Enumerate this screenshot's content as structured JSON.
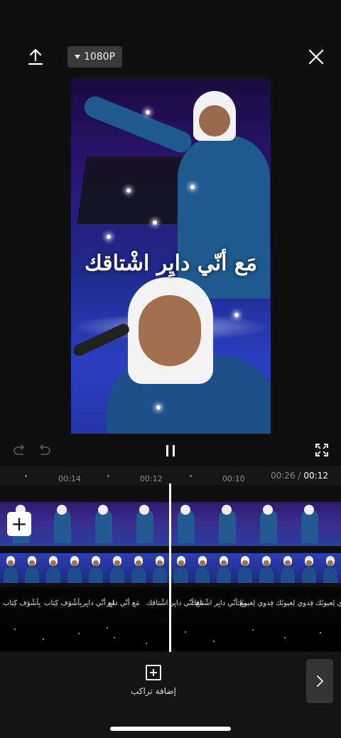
{
  "top_bar": {
    "export_icon": "upload-icon",
    "resolution_label": "1080P",
    "close_icon": "close-icon"
  },
  "preview": {
    "lyric_text": "مَع أنّي دايِر اشْتاقك"
  },
  "controls": {
    "redo_icon": "redo-icon",
    "undo_icon": "undo-icon",
    "pause_icon": "pause-icon",
    "fullscreen_icon": "fullscreen-icon"
  },
  "timeline": {
    "ticks": [
      "00:14",
      "00:12",
      "00:10"
    ],
    "current_time": "00:26",
    "separator": "/",
    "total_time": "00:12",
    "lyric_clips": [
      "مع أنّي دايِر اشْتاقك",
      "مَع أنّي دايِر اشْتاقك",
      "فِدوي لِعيونَك",
      "فِدوي لِعيونَك",
      "مَع أنّي دايِر",
      "مَع أنّي دايِر",
      "بِأشْوَف كِتاب",
      "بِأشْوَف كِتاب"
    ]
  },
  "toolbar": {
    "add_track_label": "إضافة تراكب",
    "next_icon": "chevron-right-icon"
  }
}
